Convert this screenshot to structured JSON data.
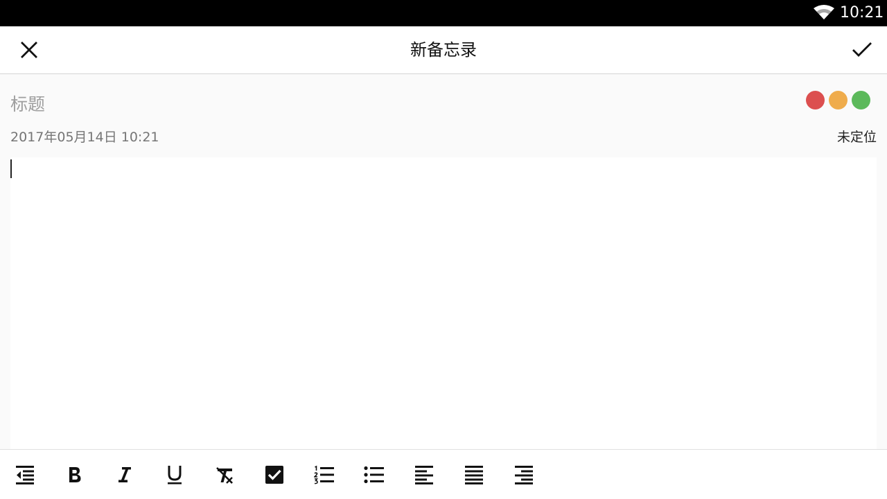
{
  "status_bar": {
    "time": "10:21",
    "wifi_icon": "wifi-icon"
  },
  "app_bar": {
    "title": "新备忘录",
    "close_icon": "close-icon",
    "confirm_icon": "check-icon"
  },
  "note": {
    "title_placeholder": "标题",
    "title_value": "",
    "date": "2017年05月14日 10:21",
    "location": "未定位",
    "body": "",
    "colors": [
      "#dc4f4f",
      "#efac4c",
      "#5cb95b"
    ]
  },
  "toolbar": {
    "tools": [
      {
        "name": "indent-decrease",
        "icon": "indent-decrease-icon"
      },
      {
        "name": "bold",
        "icon": "bold-icon"
      },
      {
        "name": "italic",
        "icon": "italic-icon"
      },
      {
        "name": "underline",
        "icon": "underline-icon"
      },
      {
        "name": "clear-format",
        "icon": "clear-format-icon"
      },
      {
        "name": "checkbox",
        "icon": "checkbox-icon"
      },
      {
        "name": "numbered-list",
        "icon": "numbered-list-icon"
      },
      {
        "name": "bulleted-list",
        "icon": "bulleted-list-icon"
      },
      {
        "name": "align-left",
        "icon": "align-left-icon"
      },
      {
        "name": "align-justify",
        "icon": "align-justify-icon"
      },
      {
        "name": "align-right",
        "icon": "align-right-icon"
      }
    ]
  }
}
